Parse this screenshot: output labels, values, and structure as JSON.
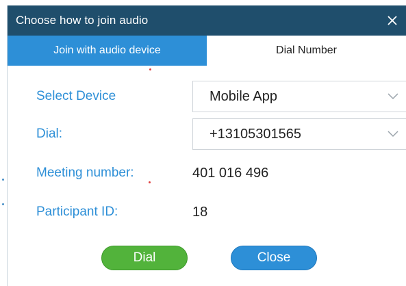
{
  "dialog": {
    "title": "Choose how to join audio",
    "close_icon": "close-icon"
  },
  "tabs": [
    {
      "label": "Join with audio device",
      "active": false
    },
    {
      "label": "Dial Number",
      "active": true
    }
  ],
  "form": {
    "select_device": {
      "label": "Select Device",
      "value": "Mobile App"
    },
    "dial": {
      "label": "Dial:",
      "value": "+13105301565"
    },
    "meeting_number": {
      "label": "Meeting number:",
      "value": "401 016 496"
    },
    "participant_id": {
      "label": "Participant ID:",
      "value": "18"
    }
  },
  "buttons": {
    "dial_label": "Dial",
    "close_label": "Close"
  },
  "colors": {
    "titlebar": "#1f4e6c",
    "accent_blue": "#2d8fd7",
    "dial_green": "#52b33b"
  }
}
